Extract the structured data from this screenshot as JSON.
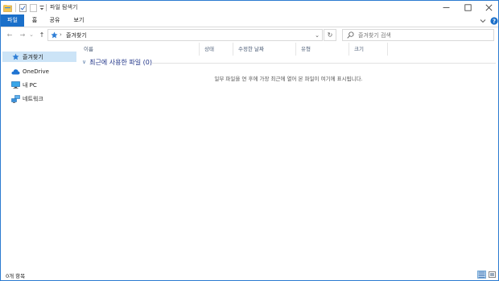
{
  "window": {
    "title": "파일 탐색기",
    "controls": {
      "minimize": "—",
      "maximize": "☐",
      "close": "✕"
    }
  },
  "ribbon": {
    "tabs": [
      {
        "label": "파일",
        "active": true
      },
      {
        "label": "홈",
        "active": false
      },
      {
        "label": "공유",
        "active": false
      },
      {
        "label": "보기",
        "active": false
      }
    ],
    "expand_icon": "chevron-down",
    "help_icon": "?"
  },
  "address": {
    "back": "←",
    "forward": "→",
    "recent": "⌄",
    "up": "↑",
    "separator": "›",
    "path": "즐겨찾기",
    "dropdown": "⌄",
    "refresh": "↻"
  },
  "search": {
    "placeholder": "즐겨찾기 검색"
  },
  "nav": {
    "items": [
      {
        "label": "즐겨찾기",
        "icon": "star-icon",
        "selected": true
      },
      {
        "label": "OneDrive",
        "icon": "cloud-icon",
        "selected": false
      },
      {
        "label": "내 PC",
        "icon": "pc-icon",
        "selected": false
      },
      {
        "label": "네트워크",
        "icon": "network-icon",
        "selected": false
      }
    ]
  },
  "columns": [
    "이름",
    "상태",
    "수정한 날짜",
    "유형",
    "크기"
  ],
  "group": {
    "chevron": "∨",
    "title": "최근에 사용한 파일 (0)"
  },
  "empty_message": "일부 파일을 연 후에 가장 최근에 열어 본 파일이 여기에 표시됩니다.",
  "status": {
    "count": "0개 항목"
  },
  "colors": {
    "accent": "#1a6fc9",
    "selection": "#cce4f7",
    "group_title": "#1e3287"
  }
}
